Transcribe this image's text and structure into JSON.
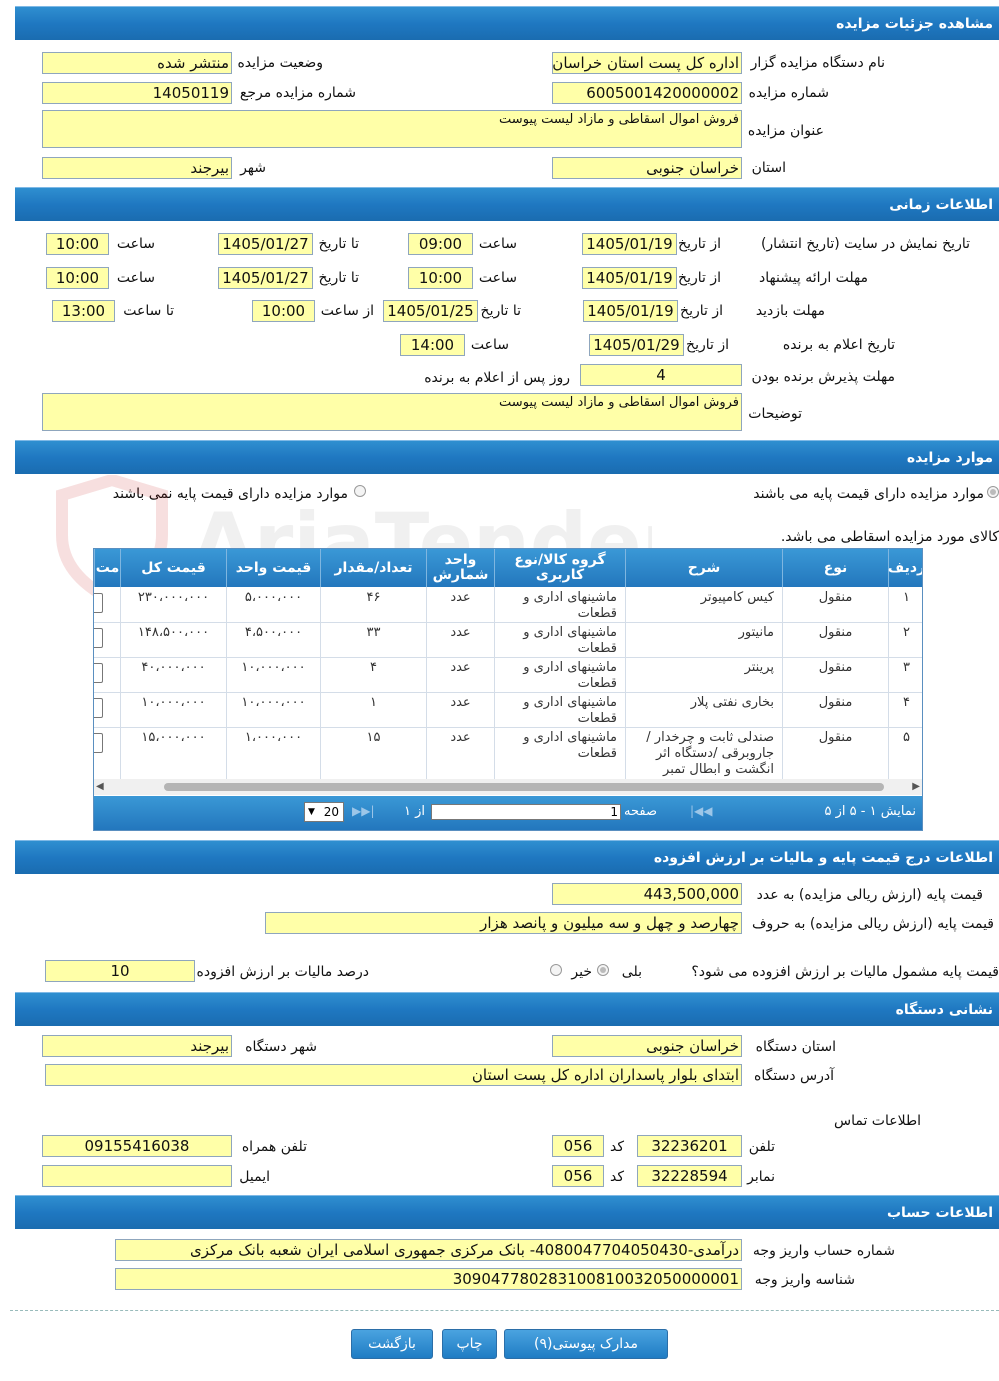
{
  "sections": {
    "details": "مشاهده جزئیات مزایده",
    "timing": "اطلاعات زمانی",
    "items": "موارد مزایده",
    "pricing": "اطلاعات درج قیمت پایه و مالیات بر ارزش افزوده",
    "address": "نشانی دستگاه",
    "account": "اطلاعات حساب"
  },
  "details": {
    "org_label": "نام دستگاه مزایده گزار",
    "org_value": "اداره کل پست استان خراسان جنوبی",
    "status_label": "وضعیت مزایده",
    "status_value": "منتشر شده",
    "number_label": "شماره مزایده",
    "number_value": "6005001420000002",
    "ref_label": "شماره مزایده مرجع",
    "ref_value": "14050119",
    "title_label": "عنوان مزایده",
    "title_value": "فروش اموال اسقاطی و مازاد لیست پیوست",
    "province_label": "استان",
    "province_value": "خراسان جنوبی",
    "city_label": "شهر",
    "city_value": "بیرجند"
  },
  "timing": {
    "display_label": "تاریخ نمایش در سایت (تاریخ انتشار)",
    "offer_label": "مهلت ارائه پیشنهاد",
    "visit_label": "مهلت بازدید",
    "announce_label": "تاریخ اعلام به برنده",
    "accept_label": "مهلت پذیرش برنده بودن",
    "from_date": "از تاریخ",
    "to_date": "تا تاریخ",
    "time": "ساعت",
    "from_time": "از ساعت",
    "to_time": "تا ساعت",
    "display_from_date": "1405/01/19",
    "display_from_time": "09:00",
    "display_to_date": "1405/01/27",
    "display_to_time": "10:00",
    "offer_from_date": "1405/01/19",
    "offer_from_time": "10:00",
    "offer_to_date": "1405/01/27",
    "offer_to_time": "10:00",
    "visit_from_date": "1405/01/19",
    "visit_to_date": "1405/01/25",
    "visit_from_time": "10:00",
    "visit_to_time": "13:00",
    "announce_date": "1405/01/29",
    "announce_time": "14:00",
    "accept_days": "4",
    "accept_suffix": "روز پس از اعلام به برنده",
    "notes_label": "توضیحات",
    "notes_value": "فروش اموال اسقاطی و مازاد لیست پیوست"
  },
  "items": {
    "radio_with_base": "موارد مزایده دارای قیمت پایه می باشند",
    "radio_without_base": "موارد مزایده دارای قیمت پایه نمی باشند",
    "scrap_note": "کالای مورد مزایده اسقاطی می باشد.",
    "columns": [
      "ردیف",
      "نوع",
      "شرح",
      "گروه کالا/نوع کاربری",
      "واحد شمارش",
      "تعداد/مقدار",
      "قیمت واحد",
      "قیمت کل",
      "مت"
    ],
    "rows": [
      {
        "idx": "۱",
        "type": "منقول",
        "desc": "کیس کامپیوتر",
        "group": "ماشینهای اداری و قطعات",
        "unit": "عدد",
        "qty": "۴۶",
        "unit_price": "۵،۰۰۰،۰۰۰",
        "total": "۲۳۰،۰۰۰،۰۰۰"
      },
      {
        "idx": "۲",
        "type": "منقول",
        "desc": "مانیتور",
        "group": "ماشینهای اداری و قطعات",
        "unit": "عدد",
        "qty": "۳۳",
        "unit_price": "۴،۵۰۰،۰۰۰",
        "total": "۱۴۸،۵۰۰،۰۰۰"
      },
      {
        "idx": "۳",
        "type": "منقول",
        "desc": "پرینتر",
        "group": "ماشینهای اداری و قطعات",
        "unit": "عدد",
        "qty": "۴",
        "unit_price": "۱۰،۰۰۰،۰۰۰",
        "total": "۴۰،۰۰۰،۰۰۰"
      },
      {
        "idx": "۴",
        "type": "منقول",
        "desc": "بخاری نفتی پلار",
        "group": "ماشینهای اداری و قطعات",
        "unit": "عدد",
        "qty": "۱",
        "unit_price": "۱۰،۰۰۰،۰۰۰",
        "total": "۱۰،۰۰۰،۰۰۰"
      },
      {
        "idx": "۵",
        "type": "منقول",
        "desc": "صندلی ثابت و چرخدار / جاروبرقی /دستگاه اثر انگشت و ابطال تمبر",
        "group": "ماشینهای اداری و قطعات",
        "unit": "عدد",
        "qty": "۱۵",
        "unit_price": "۱،۰۰۰،۰۰۰",
        "total": "۱۵،۰۰۰،۰۰۰"
      }
    ],
    "pager": {
      "summary": "نمایش ۱ - ۵ از ۵",
      "page_label": "صفحه",
      "page_value": "1",
      "of_label": "از ۱",
      "page_size": "20"
    }
  },
  "pricing": {
    "base_num_label": "قیمت پایه (ارزش ریالی مزایده) به عدد",
    "base_num_value": "443,500,000",
    "base_words_label": "قیمت پایه (ارزش ریالی مزایده) به حروف",
    "base_words_value": "چهارصد و چهل و سه میلیون و پانصد هزار",
    "vat_question": "قیمت پایه مشمول مالیات بر ارزش افزوده می شود؟",
    "yes": "بلی",
    "no": "خیر",
    "vat_percent_label": "درصد مالیات بر ارزش افزوده",
    "vat_percent_value": "10"
  },
  "address": {
    "province_label": "استان دستگاه",
    "province_value": "خراسان جنوبی",
    "city_label": "شهر دستگاه",
    "city_value": "بیرجند",
    "address_label": "آدرس دستگاه",
    "address_value": "ابتدای بلوار پاسداران اداره کل پست استان",
    "contact_label": "اطلاعات تماس",
    "phone_label": "تلفن",
    "phone_value": "32236201",
    "code_label": "کد",
    "phone_code": "056",
    "mobile_label": "تلفن همراه",
    "mobile_value": "09155416038",
    "fax_label": "نمابر",
    "fax_value": "32228594",
    "fax_code": "056",
    "email_label": "ایمیل",
    "email_value": ""
  },
  "account": {
    "acc_label": "شماره حساب واریز وجه",
    "acc_value": "درآمدی-4080047704050430- بانک مرکزی جمهوری اسلامی ایران شعبه بانک مرکزی",
    "id_label": "شناسه واریز وجه",
    "id_value": "309047780283100810032050000001"
  },
  "buttons": {
    "attachments": "مدارک پیوستی(۹)",
    "print": "چاپ",
    "back": "بازگشت"
  },
  "watermark": "AriaTender.com"
}
